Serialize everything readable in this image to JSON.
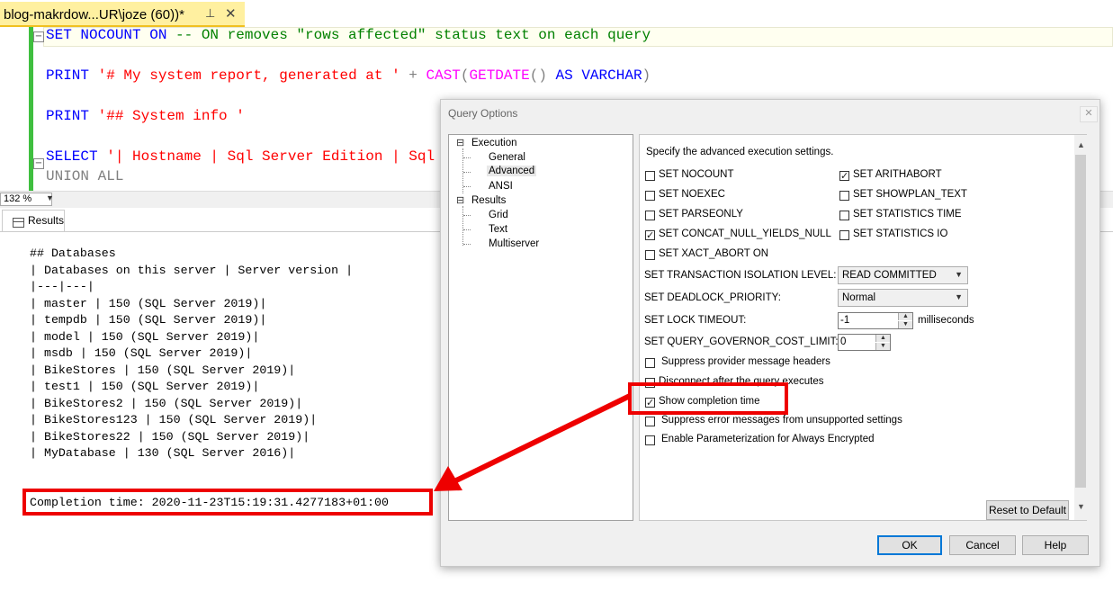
{
  "tab": {
    "title": "blog-makrdow...UR\\joze (60))*",
    "pin": "⊥",
    "close": "✕"
  },
  "editor": {
    "line1": {
      "kw1": "SET NOCOUNT ON",
      "comment": " -- ON removes \"rows affected\" status text on each query"
    },
    "line2": {
      "kw": "PRINT",
      "str": " '# My system report, generated at '",
      "op": " + ",
      "fn1": "CAST",
      "p1": "(",
      "fn2": "GETDATE",
      "p2": "()",
      "kw2": " AS VARCHAR",
      "p3": ")"
    },
    "line3": {
      "kw": "PRINT",
      "str": " '## System info '"
    },
    "line4": {
      "kw": "SELECT",
      "str": " '| Hostname | Sql Server Edition | Sql S"
    },
    "line5": {
      "kw": "UNION",
      "kw2": " ALL"
    }
  },
  "zoom": {
    "value": "132 %"
  },
  "results": {
    "tab_label": "Results",
    "lines": [
      "## Databases",
      "| Databases on this server | Server version |",
      "|---|---|",
      "| master | 150 (SQL Server 2019)|",
      "| tempdb | 150 (SQL Server 2019)|",
      "| model | 150 (SQL Server 2019)|",
      "| msdb | 150 (SQL Server 2019)|",
      "| BikeStores | 150 (SQL Server 2019)|",
      "| test1 | 150 (SQL Server 2019)|",
      "| BikeStores2 | 150 (SQL Server 2019)|",
      "| BikeStores123 | 150 (SQL Server 2019)|",
      "| BikeStores22 | 150 (SQL Server 2019)|",
      "| MyDatabase | 130 (SQL Server 2016)|"
    ],
    "completion": "Completion time: 2020-11-23T15:19:31.4277183+01:00"
  },
  "dialog": {
    "title": "Query Options",
    "close": "✕",
    "tree": {
      "execution": "Execution",
      "general": "General",
      "advanced": "Advanced",
      "ansi": "ANSI",
      "results": "Results",
      "grid": "Grid",
      "text": "Text",
      "multiserver": "Multiserver"
    },
    "description": "Specify the advanced execution settings.",
    "checkboxes": {
      "set_nocount": {
        "label": "SET NOCOUNT",
        "checked": false
      },
      "set_arithabort": {
        "label": "SET ARITHABORT",
        "checked": true
      },
      "set_noexec": {
        "label": "SET NOEXEC",
        "checked": false
      },
      "set_showplan_text": {
        "label": "SET SHOWPLAN_TEXT",
        "checked": false
      },
      "set_parseonly": {
        "label": "SET PARSEONLY",
        "checked": false
      },
      "set_statistics_time": {
        "label": "SET STATISTICS TIME",
        "checked": false
      },
      "set_concat_null": {
        "label": "SET CONCAT_NULL_YIELDS_NULL",
        "checked": true
      },
      "set_statistics_io": {
        "label": "SET STATISTICS IO",
        "checked": false
      },
      "set_xact_abort": {
        "label": "SET XACT_ABORT ON",
        "checked": false
      },
      "suppress_provider": {
        "label": "Suppress provider message headers",
        "checked": false
      },
      "disconnect_after": {
        "label": "Disconnect after the query executes",
        "checked": false
      },
      "show_completion": {
        "label": "Show completion time",
        "checked": true
      },
      "suppress_errors": {
        "label": "Suppress error messages from unsupported settings",
        "checked": false
      },
      "enable_param": {
        "label": "Enable Parameterization for Always Encrypted",
        "checked": false
      }
    },
    "fields": {
      "isolation_label": "SET TRANSACTION ISOLATION LEVEL:",
      "isolation_value": "READ COMMITTED",
      "deadlock_label": "SET DEADLOCK_PRIORITY:",
      "deadlock_value": "Normal",
      "lock_timeout_label": "SET LOCK TIMEOUT:",
      "lock_timeout_value": "-1",
      "lock_timeout_unit": "milliseconds",
      "governor_label": "SET QUERY_GOVERNOR_COST_LIMIT:",
      "governor_value": "0"
    },
    "buttons": {
      "reset": "Reset to Default",
      "ok": "OK",
      "cancel": "Cancel",
      "help": "Help"
    }
  },
  "annotation": {
    "color": "#ee0000"
  }
}
